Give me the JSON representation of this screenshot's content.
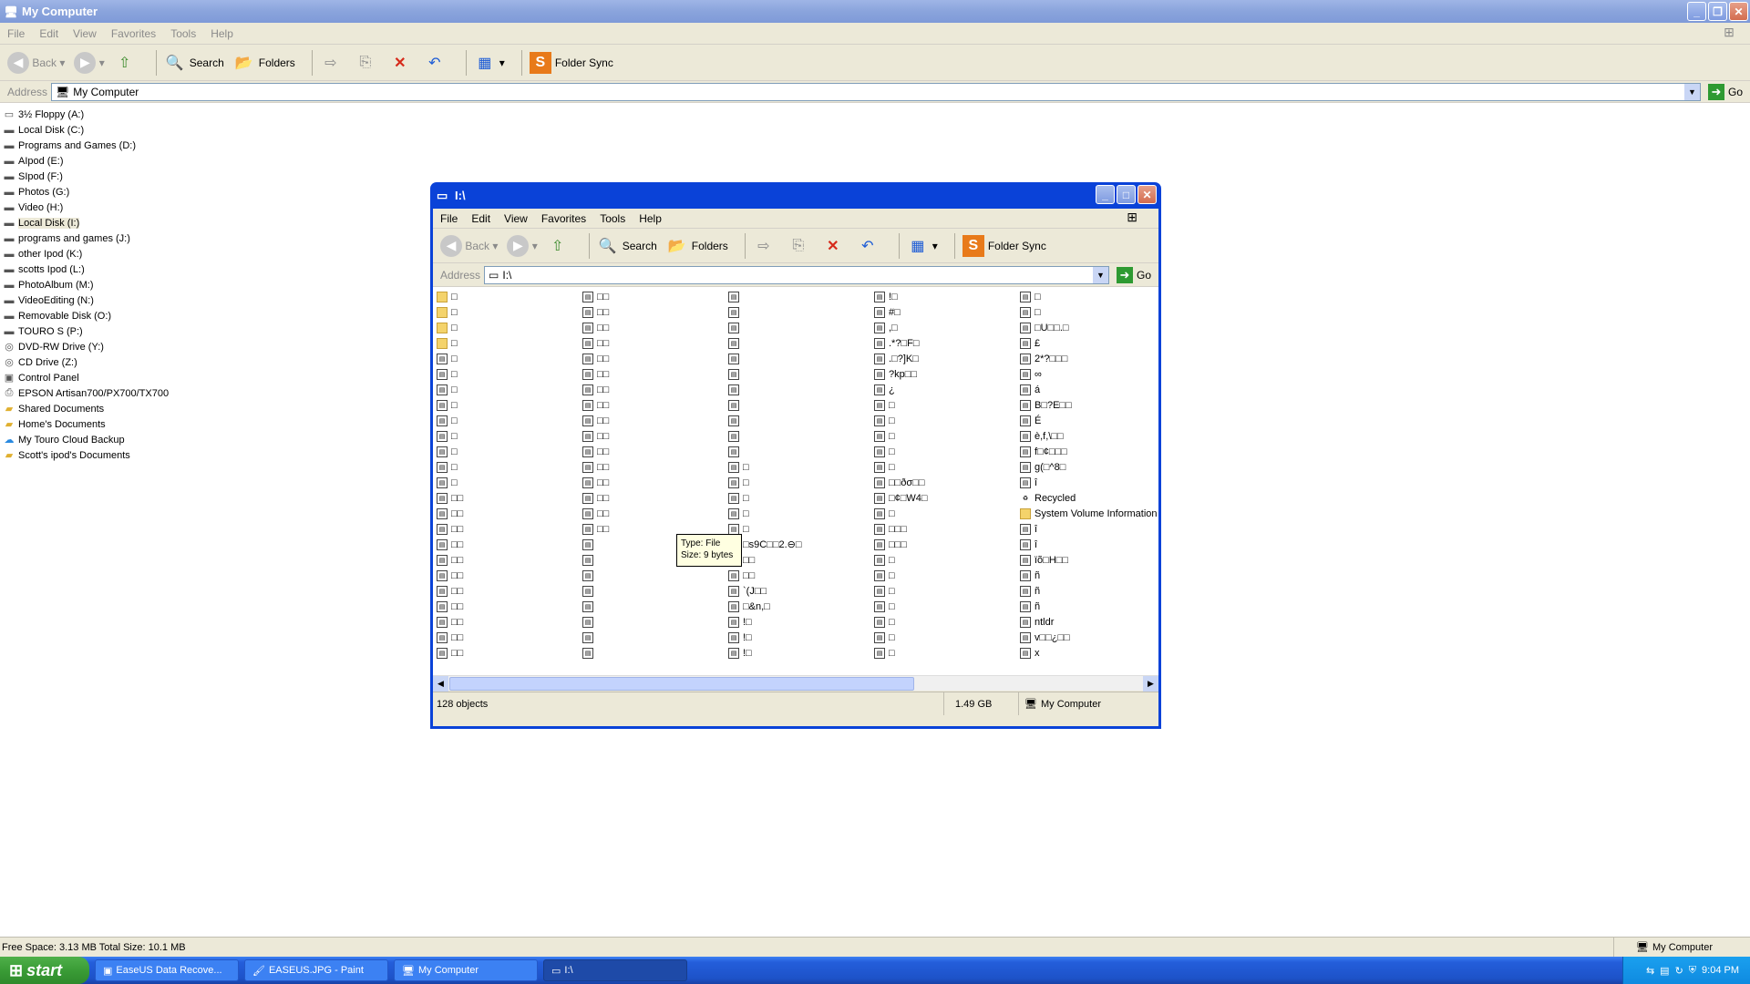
{
  "main": {
    "title": "My Computer",
    "menu": [
      "File",
      "Edit",
      "View",
      "Favorites",
      "Tools",
      "Help"
    ],
    "toolbar": {
      "back": "Back",
      "search": "Search",
      "folders": "Folders",
      "sync": "Folder Sync"
    },
    "address_label": "Address",
    "address_value": "My Computer",
    "go": "Go",
    "tree": [
      {
        "label": "3½ Floppy (A:)",
        "icon": "floppy-icon"
      },
      {
        "label": "Local Disk (C:)",
        "icon": "drive-icon"
      },
      {
        "label": "Programs and Games (D:)",
        "icon": "drive-icon"
      },
      {
        "label": "AIpod (E:)",
        "icon": "drive-icon"
      },
      {
        "label": "SIpod (F:)",
        "icon": "drive-icon"
      },
      {
        "label": "Photos (G:)",
        "icon": "drive-icon"
      },
      {
        "label": "Video (H:)",
        "icon": "drive-icon"
      },
      {
        "label": "Local Disk (I:)",
        "icon": "drive-icon"
      },
      {
        "label": "programs and games (J:)",
        "icon": "drive-icon"
      },
      {
        "label": "other Ipod (K:)",
        "icon": "drive-icon"
      },
      {
        "label": "scotts Ipod (L:)",
        "icon": "drive-icon"
      },
      {
        "label": "PhotoAlbum (M:)",
        "icon": "drive-icon"
      },
      {
        "label": "VideoEditing (N:)",
        "icon": "drive-icon"
      },
      {
        "label": "Removable Disk (O:)",
        "icon": "drive-icon"
      },
      {
        "label": "TOURO S (P:)",
        "icon": "drive-icon"
      },
      {
        "label": "DVD-RW Drive (Y:)",
        "icon": "cd-icon"
      },
      {
        "label": "CD Drive (Z:)",
        "icon": "cd-icon"
      },
      {
        "label": "Control Panel",
        "icon": "control-panel-icon"
      },
      {
        "label": "EPSON Artisan700/PX700/TX700",
        "icon": "printer-icon"
      },
      {
        "label": "Shared Documents",
        "icon": "folder-icon"
      },
      {
        "label": "Home's Documents",
        "icon": "folder-icon"
      },
      {
        "label": "My Touro Cloud Backup",
        "icon": "cloud-icon"
      },
      {
        "label": "Scott's ipod's Documents",
        "icon": "folder-icon"
      }
    ],
    "status_left": "Free Space: 3.13 MB Total Size: 10.1 MB",
    "status_right": "My Computer"
  },
  "child": {
    "title": "I:\\",
    "menu": [
      "File",
      "Edit",
      "View",
      "Favorites",
      "Tools",
      "Help"
    ],
    "address_value": "I:\\",
    "status_objects": "128 objects",
    "status_size": "1.49 GB",
    "status_location": "My Computer",
    "columns": [
      [
        "□",
        "□",
        "□",
        "□",
        "□",
        "□",
        "□",
        "□",
        "□",
        "□",
        "□",
        "□",
        "□",
        "□□",
        "□□",
        "□□",
        "□□",
        "□□",
        "□□",
        "□□",
        "□□",
        "□□",
        "□□",
        "□□",
        "□□"
      ],
      [
        "□□",
        "□□",
        "□□",
        "□□",
        "□□",
        "□□",
        "□□",
        "□□",
        "□□",
        "□□",
        "□□",
        "□□",
        "□□",
        "□□",
        "□□",
        "□□",
        "",
        "",
        "",
        "",
        "",
        "",
        "",
        "",
        ""
      ],
      [
        "",
        "",
        "",
        "",
        "",
        "",
        "",
        "",
        "",
        "",
        "",
        "□",
        "□",
        "□",
        "□",
        "□",
        "□s9C□□2.⊖□",
        "□□",
        "□□",
        "`(J□□",
        "□&n,□",
        "!□",
        "!□",
        "!□",
        ""
      ],
      [
        "!□",
        "#□",
        ",□",
        ".*?□F□",
        ".□?]K□",
        "?kp□□",
        "¿",
        "□",
        "□",
        "□",
        "□",
        "□",
        "□□ðσ□□",
        "□¢□W4□",
        "□",
        "□□□",
        "□□□",
        "□",
        "□",
        "□",
        "□",
        "□",
        "□",
        "□",
        ""
      ],
      [
        "□",
        "□",
        "□U□□.□",
        "£",
        "2*?□□□",
        "∞",
        "á",
        "B□?E□□",
        "É",
        "è,f,\\□□",
        "f□¢□□□",
        "g(□^8□",
        "î",
        "Recycled",
        "System Volume Information",
        "î",
        "î",
        "ïõ□H□□",
        "ñ",
        "ñ",
        "ñ",
        "ntldr",
        "v□□¿□□",
        "x",
        ""
      ]
    ],
    "folder_rows": 4,
    "tooltip_line1": "Type: File",
    "tooltip_line2": "Size: 9 bytes"
  },
  "taskbar": {
    "start": "start",
    "tasks": [
      "EaseUS Data Recove...",
      "EASEUS.JPG - Paint",
      "My Computer",
      "I:\\"
    ],
    "clock": "9:04 PM"
  }
}
